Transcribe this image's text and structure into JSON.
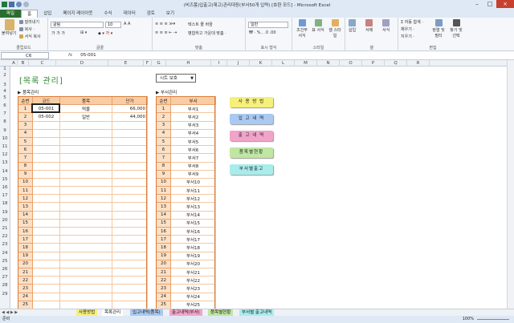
{
  "window": {
    "title": "(비즈폼)입출고(재고)관리대장(부서50개 입력) [호환 모드] - Microsoft Excel"
  },
  "tabs": [
    "파일",
    "홈",
    "삽입",
    "페이지 레이아웃",
    "수식",
    "데이터",
    "검토",
    "보기"
  ],
  "ribbon": {
    "paste": "붙여넣기",
    "cut": "잘라내기",
    "copy": "복사 ·",
    "format_painter": "서식 복사",
    "clipboard": "클립보드",
    "font_name": "굴림",
    "font_size": "10",
    "font": "글꼴",
    "wrap": "텍스트 줄 바꿈",
    "merge": "병합하고 가운데 맞춤 ·",
    "align": "맞춤",
    "number_format": "일반",
    "number": "표시 형식",
    "cond_format": "조건부 서식",
    "table_format": "표 서식",
    "cell_style": "셀 스타일",
    "styles": "스타일",
    "insert": "삽입",
    "delete": "삭제",
    "format": "서식",
    "cells": "셀",
    "autosum": "Σ 자동 합계 ·",
    "fill": "채우기 ·",
    "clear": "지우기 ·",
    "sort": "정렬 및 필터",
    "find": "찾기 및 선택",
    "editing": "편집"
  },
  "formula_bar": {
    "cell": "C6",
    "fx": "fx",
    "value": "05-001"
  },
  "columns": [
    "A",
    "B",
    "C",
    "D",
    "E",
    "F",
    "G",
    "H",
    "I",
    "J",
    "K",
    "L",
    "M",
    "N",
    "O",
    "P",
    "Q",
    "R"
  ],
  "rows": [
    "1",
    "2",
    "3",
    "4",
    "5",
    "6",
    "7",
    "8",
    "9",
    "10",
    "11",
    "12",
    "13",
    "14",
    "15",
    "16",
    "17",
    "18",
    "19",
    "20",
    "21",
    "22",
    "23",
    "24",
    "25",
    "26",
    "27",
    "28",
    "29"
  ],
  "sheet": {
    "title": "[목록 관리]",
    "protect": "시트 보호",
    "protect_arrow": "▼",
    "left_section": "▶ 품목관리",
    "right_section": "▶ 부서관리",
    "left_headers": [
      "순번",
      "코드",
      "품목",
      "단가"
    ],
    "right_headers": [
      "순번",
      "부서"
    ],
    "items": [
      {
        "no": "1",
        "code": "05-001",
        "name": "먹물",
        "price": "66,000"
      },
      {
        "no": "2",
        "code": "05-002",
        "name": "일반",
        "price": "44,000"
      }
    ],
    "item_rows": [
      "1",
      "2",
      "3",
      "4",
      "5",
      "6",
      "7",
      "8",
      "9",
      "10",
      "11",
      "12",
      "13",
      "14",
      "15",
      "16",
      "17",
      "18",
      "19",
      "20",
      "21",
      "22",
      "23",
      "24",
      "25",
      "26"
    ],
    "depts": [
      "부서1",
      "부서2",
      "부서3",
      "부서4",
      "부서5",
      "부서6",
      "부서7",
      "부서8",
      "부서9",
      "부서10",
      "부서11",
      "부서12",
      "부서13",
      "부서14",
      "부서15",
      "부서16",
      "부서17",
      "부서18",
      "부서19",
      "부서20",
      "부서21",
      "부서22",
      "부서23",
      "부서24",
      "부서25",
      "부서26"
    ]
  },
  "buttons": [
    {
      "label": "사 용 방 법",
      "color": "#f5f07a"
    },
    {
      "label": "입 고 내 역",
      "color": "#a9c9f2"
    },
    {
      "label": "출 고 내 역",
      "color": "#f2a3c8"
    },
    {
      "label": "품목별현황",
      "color": "#bfe6a2"
    },
    {
      "label": "부서별출고",
      "color": "#a8ecec"
    }
  ],
  "sheet_tabs": [
    {
      "label": "사용방법",
      "color": "#f5f07a"
    },
    {
      "label": "목록관리",
      "color": "#ffffff"
    },
    {
      "label": "입고내역(품목)",
      "color": "#a9c9f2"
    },
    {
      "label": "출고내역(부서)",
      "color": "#f2a3c8"
    },
    {
      "label": "품목별현황",
      "color": "#bfe6a2"
    },
    {
      "label": "부서별 출고내역",
      "color": "#a8ecec"
    }
  ],
  "status": {
    "ready": "준비",
    "zoom": "100%"
  }
}
